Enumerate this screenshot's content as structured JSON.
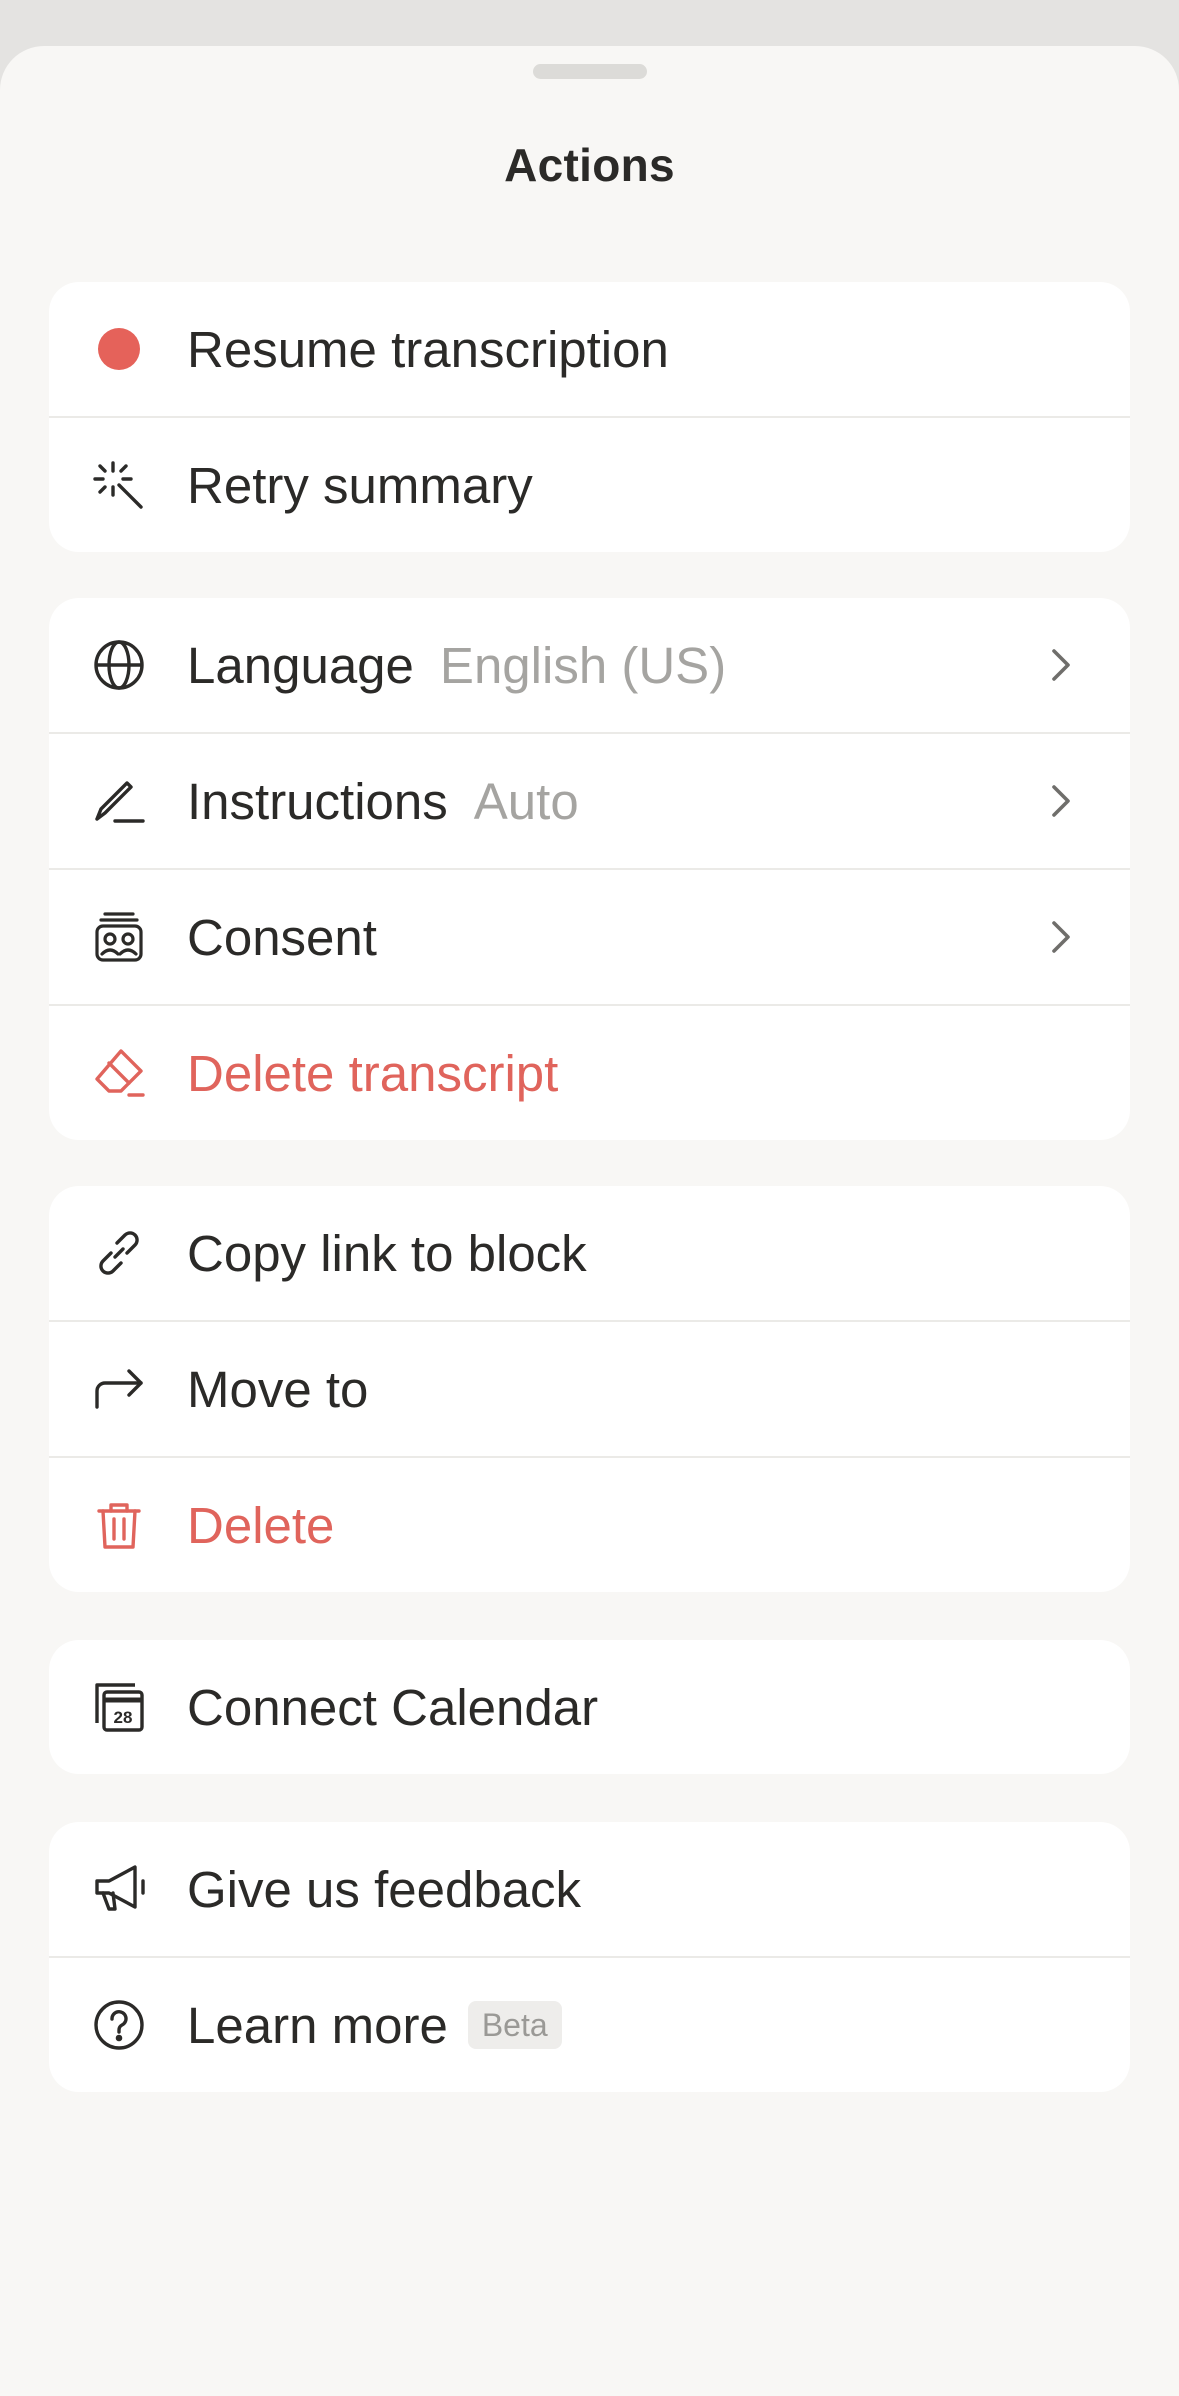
{
  "sheet": {
    "title": "Actions"
  },
  "groups": {
    "transcription": {
      "resume_label": "Resume transcription",
      "retry_label": "Retry summary"
    },
    "settings": {
      "language_label": "Language",
      "language_value": "English (US)",
      "instructions_label": "Instructions",
      "instructions_value": "Auto",
      "consent_label": "Consent",
      "delete_transcript_label": "Delete transcript"
    },
    "block": {
      "copy_link_label": "Copy link to block",
      "move_to_label": "Move to",
      "delete_label": "Delete"
    },
    "calendar": {
      "connect_label": "Connect Calendar",
      "calendar_day": "28"
    },
    "help": {
      "feedback_label": "Give us feedback",
      "learn_more_label": "Learn more",
      "beta_badge": "Beta"
    }
  },
  "icons": {
    "resume": "record-dot-icon",
    "retry": "sparkle-burst-icon",
    "language": "globe-icon",
    "instructions": "pen-line-icon",
    "consent": "people-badge-icon",
    "delete_transcript": "eraser-icon",
    "copy_link": "link-icon",
    "move_to": "arrow-turn-right-icon",
    "delete": "trash-icon",
    "calendar": "calendar-icon",
    "feedback": "megaphone-icon",
    "learn_more": "question-circle-icon",
    "chevron": "chevron-right-icon"
  },
  "colors": {
    "destructive": "#e0645c",
    "record": "#e5625a",
    "text": "#2b2a28",
    "secondary_text": "#a5a4a1",
    "background": "#f8f7f5",
    "card": "#ffffff"
  }
}
